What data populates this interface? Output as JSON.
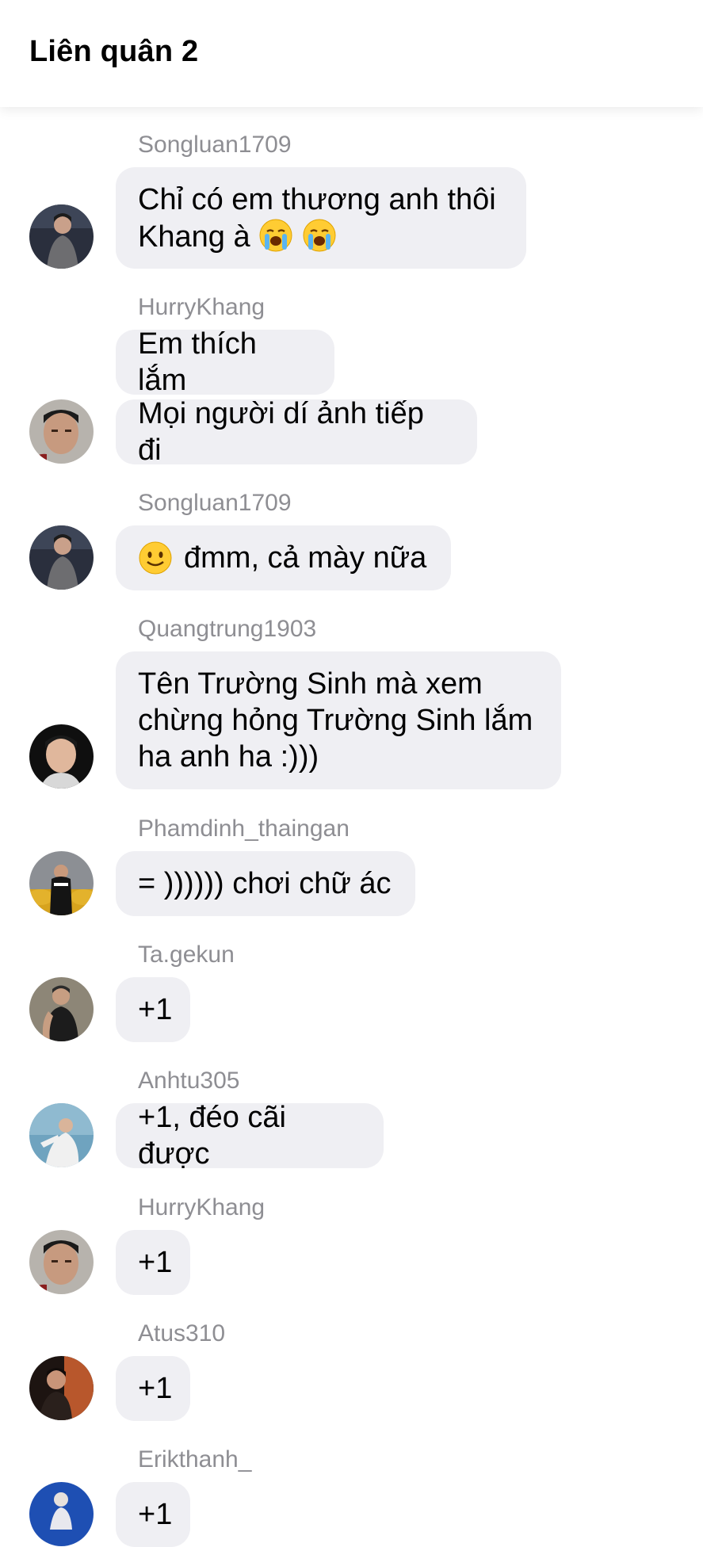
{
  "header": {
    "title": "Liên quân 2"
  },
  "messages": [
    {
      "sender": "Songluan1709",
      "lines": [
        "Chỉ có em thương anh thôi",
        "Khang à"
      ]
    },
    {
      "sender": "HurryKhang",
      "bubbles": [
        "Em thích lắm",
        "Mọi người dí ảnh tiếp đi"
      ]
    },
    {
      "sender": "Songluan1709",
      "text": "đmm, cả mày nữa"
    },
    {
      "sender": "Quangtrung1903",
      "text": "Tên Trường Sinh mà xem\nchừng hỏng Trường Sinh lắm\nha anh ha :)))"
    },
    {
      "sender": "Phamdinh_thaingan",
      "text": "= )))))) chơi chữ ác"
    },
    {
      "sender": "Ta.gekun",
      "text": "+1"
    },
    {
      "sender": "Anhtu305",
      "text": "+1, đéo cãi được"
    },
    {
      "sender": "HurryKhang",
      "text": "+1"
    },
    {
      "sender": "Atus310",
      "text": "+1"
    },
    {
      "sender": "Erikthanh_",
      "text": "+1"
    }
  ],
  "icons": {
    "crying_emoji": "loudly-crying-face-icon",
    "slight_smile_emoji": "slightly-smiling-face-icon"
  },
  "colors": {
    "bubble": "#efeff3",
    "sender_name": "#8e8e93",
    "text": "#000000",
    "background": "#ffffff"
  }
}
